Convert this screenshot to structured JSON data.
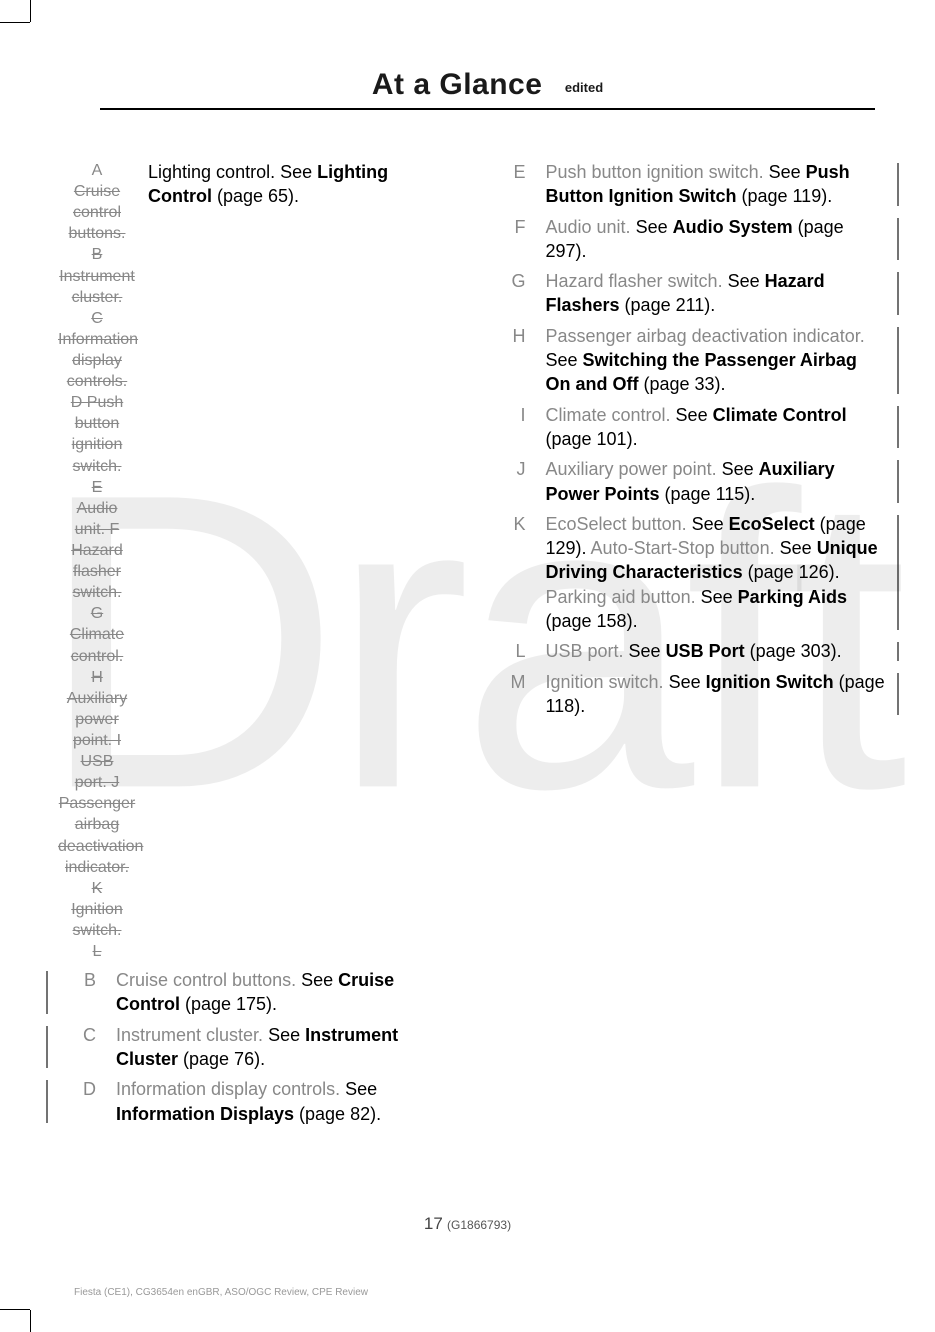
{
  "watermark": "Draft",
  "header": {
    "title": "At a Glance",
    "subtitle": "edited"
  },
  "left_struck": {
    "first_letter": "A",
    "first_line_prefix": "Lighting control. See ",
    "first_line_bold": "Lighting Control",
    "first_line_page": " (page 65).",
    "lines": [
      "Cruise",
      "control",
      "buttons.",
      "B",
      "Instrument",
      "cluster.",
      "C",
      "Information",
      "display",
      "controls.",
      "D  Push",
      "button",
      "ignition",
      "switch.",
      "E",
      "Audio",
      "unit.  F",
      "Hazard",
      "flasher",
      "switch.",
      "G",
      "Climate",
      "control.",
      "H",
      "Auxiliary",
      "power",
      "point.  I",
      "USB",
      "port.  J",
      "Passenger",
      "airbag",
      "deactivation",
      "indicator.",
      "K",
      "Ignition",
      "switch.",
      "L"
    ]
  },
  "left_items": [
    {
      "letter": "B",
      "pre": "Cruise control buttons.  ",
      "see": "See ",
      "bold": "Cruise Control",
      "page": " (page 175).",
      "bar": "left"
    },
    {
      "letter": "C",
      "pre": "Instrument cluster.  ",
      "see": "See ",
      "bold": "Instrument Cluster",
      "page": " (page 76).",
      "bar": "left"
    },
    {
      "letter": "D",
      "pre": "Information display controls. ",
      "see": "See ",
      "bold": "Information Displays",
      "page": " (page 82).",
      "bar": "left"
    }
  ],
  "right_items": [
    {
      "letter": "E",
      "pre": "Push button ignition switch.  ",
      "see": "See ",
      "bold": "Push Button Ignition Switch",
      "page": " (page 119).",
      "bar": "right"
    },
    {
      "letter": "F",
      "pre": "Audio unit.  ",
      "see": "See ",
      "bold": "Audio System",
      "page": " (page 297).",
      "bar": "right"
    },
    {
      "letter": "G",
      "pre": "Hazard flasher switch.  ",
      "see": "See ",
      "bold": "Hazard Flashers",
      "page": " (page 211).",
      "bar": "right"
    },
    {
      "letter": "H",
      "pre": "Passenger airbag deactivation indicator.  ",
      "see": "See ",
      "bold": "Switching the Passenger Airbag On and Off",
      "page": " (page 33).",
      "bar": "right"
    },
    {
      "letter": "I",
      "pre": "Climate control.  ",
      "see": "See ",
      "bold": "Climate Control",
      "page": " (page 101).",
      "bar": "right"
    },
    {
      "letter": "J",
      "pre": "Auxiliary power point.  ",
      "see": "See ",
      "bold": "Auxiliary Power Points",
      "page": " (page 115).",
      "bar": "right"
    },
    {
      "letter": "K",
      "multi": [
        {
          "pre": "EcoSelect button.  ",
          "see": "See ",
          "bold": "EcoSelect",
          "page": " (page 129)."
        },
        {
          "pre": "Auto-Start-Stop button.   ",
          "see": "See ",
          "bold": "Unique Driving Characteristics",
          "page": " (page 126)."
        },
        {
          "pre": "Parking aid button.  ",
          "see": "See ",
          "bold": "Parking Aids",
          "page": " (page 158)."
        }
      ],
      "bar": "right"
    },
    {
      "letter": "L",
      "pre": "USB port.  ",
      "see": "See ",
      "bold": "USB Port",
      "page": " (page 303).",
      "bar": "right"
    },
    {
      "letter": "M",
      "pre": "Ignition switch.  ",
      "see": "See ",
      "bold": "Ignition Switch",
      "page": " (page 118).",
      "bar": "right"
    }
  ],
  "footer": {
    "page_num": "17",
    "page_id": "(G1866793)",
    "note": "Fiesta (CE1), CG3654en enGBR, ASO/OGC Review, CPE Review"
  }
}
